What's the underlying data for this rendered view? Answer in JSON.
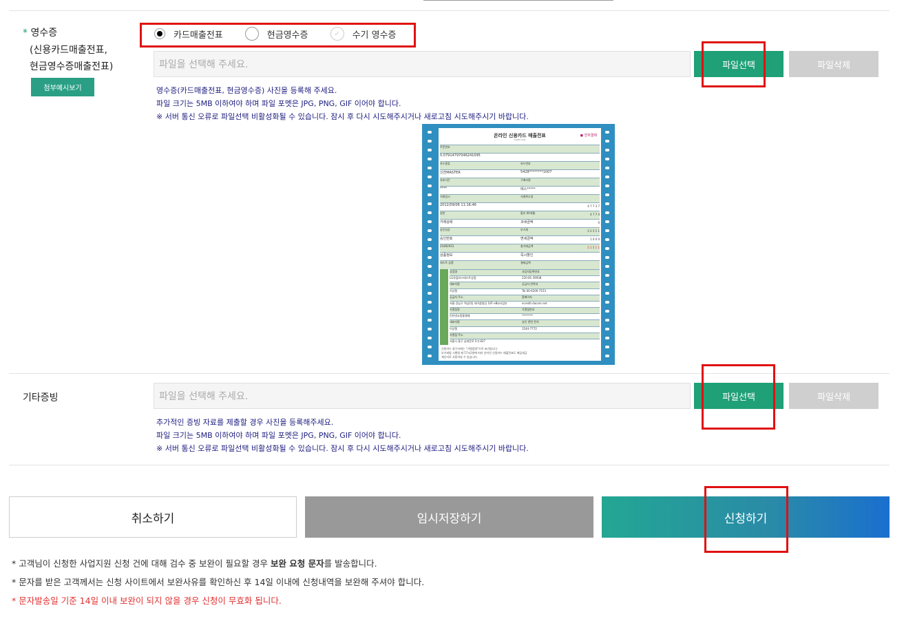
{
  "receipt_section": {
    "required_mark": "*",
    "label": "영수증",
    "label_sub1": "(신용카드매출전표,",
    "label_sub2": "현금영수증매출전표)",
    "sample_button": "첨부예시보기",
    "radio_options": [
      {
        "label": "카드매출전표",
        "state": "selected"
      },
      {
        "label": "현금영수증",
        "state": "unselected"
      },
      {
        "label": "수기 영수증",
        "state": "disabled"
      }
    ],
    "file_placeholder": "파일을 선택해 주세요.",
    "select_button": "파일선택",
    "delete_button": "파일삭제",
    "help": [
      "영수증(카드매출전표, 현금영수증) 사진을 등록해 주세요.",
      "파일 크기는 5MB 이하여야 하며 파일 포멧은 JPG, PNG, GIF 이어야 합니다.",
      "※ 서버 통신 오류로 파일선택 비활성화될 수 있습니다. 잠시 후 다시 시도해주시거나 새로고침 시도해주시기 바랍니다."
    ]
  },
  "receipt_image": {
    "title": "온라인 신용카드 매출전표",
    "subtitle": "SALES SLIP",
    "logo": "전자결제",
    "rows": [
      [
        "주문번호",
        "",
        ""
      ],
      [
        "0.07914797046241095",
        ""
      ],
      [
        "카드종류",
        "카드번호"
      ],
      [
        "신한MASTER",
        "5428********1007"
      ],
      [
        "유효기간",
        "구매자명"
      ],
      [
        "****",
        "테스*****"
      ],
      [
        "거래일시",
        "거래취소일"
      ],
      [
        "2012/09/06 11:16:46",
        ""
      ],
      [
        "일반",
        "할부 00개월"
      ],
      [
        "거래상태",
        "과세금액"
      ],
      [
        "승인성공",
        "부가세"
      ],
      [
        "승인번호",
        "면세금액"
      ],
      [
        "21892931",
        "총거래금액"
      ],
      [
        "상품정보",
        "즉시할인"
      ],
      [
        "테스트 상품",
        "결제금액"
      ]
    ],
    "amounts": [
      "4 7 7 3 7",
      "4 7 7 4",
      "0",
      "5 2 5 1 1",
      "1 0 0 0",
      "5 1 5 1 1"
    ],
    "seller": [
      [
        "상점명",
        "사업자등록번호"
      ],
      [
        "LG유플러스테스트상점",
        "220-81-39938"
      ],
      [
        "대표자명",
        "공급자 연락처"
      ],
      [
        "이상철",
        "Tel.00-6200-7153"
      ],
      [
        "공급자 주소",
        "홈페이지"
      ],
      [
        "서울 강남구 역삼2동 데이콤빌딩 10F eBiz사업부",
        "ecredit.dacom.net"
      ],
      [
        "가맹점명",
        "가맹점번호"
      ],
      [
        "인터넷쇼핑몰결제",
        "********"
      ],
      [
        "대표자명",
        "승인 관련 문의"
      ],
      [
        "이상철",
        "1544-7772"
      ],
      [
        "가맹점 주소",
        ""
      ],
      [
        "서울시 중구 남대문로 5가 827",
        ""
      ]
    ],
    "footer": [
      "신용카드 청구서에는 \"가맹점명\"으로 표기됩니다",
      "부가세법 시행령 제 57조2항에 따라 온라인 신용카드 매출전표도 매입세금",
      "계산서로 사용하실 수 있습니다."
    ]
  },
  "other_section": {
    "label": "기타증빙",
    "file_placeholder": "파일을 선택해 주세요.",
    "select_button": "파일선택",
    "delete_button": "파일삭제",
    "help": [
      "추가적인 증빙 자료를 제출할 경우 사진을 등록해주세요.",
      "파일 크기는 5MB 이하여야 하며 파일 포멧은 JPG, PNG, GIF 이어야 합니다.",
      "※ 서버 통신 오류로 파일선택 비활성화될 수 있습니다. 잠시 후 다시 시도해주시거나 새로고침 시도해주시기 바랍니다."
    ]
  },
  "actions": {
    "cancel": "취소하기",
    "temp_save": "임시저장하기",
    "apply": "신청하기"
  },
  "notes": {
    "n1_pre": "* 고객님이 신청한 사업지원 신청 건에 대해 검수 중 보완이 필요할 경우 ",
    "n1_bold": "보완 요청 문자",
    "n1_post": "를 발송합니다.",
    "n2": "* 문자를 받은 고객께서는 신청 사이트에서 보완사유를 확인하신 후 14일 이내에 신청내역을 보완해 주셔야 합니다.",
    "n3": "* 문자발송일 기준 14일 이내 보완이 되지 않을 경우 신청이 무효화 됩니다."
  },
  "colors": {
    "accent_green": "#1fa077",
    "highlight_red": "#e01010",
    "help_text": "#1c1c80",
    "warning_red": "#e03030"
  }
}
